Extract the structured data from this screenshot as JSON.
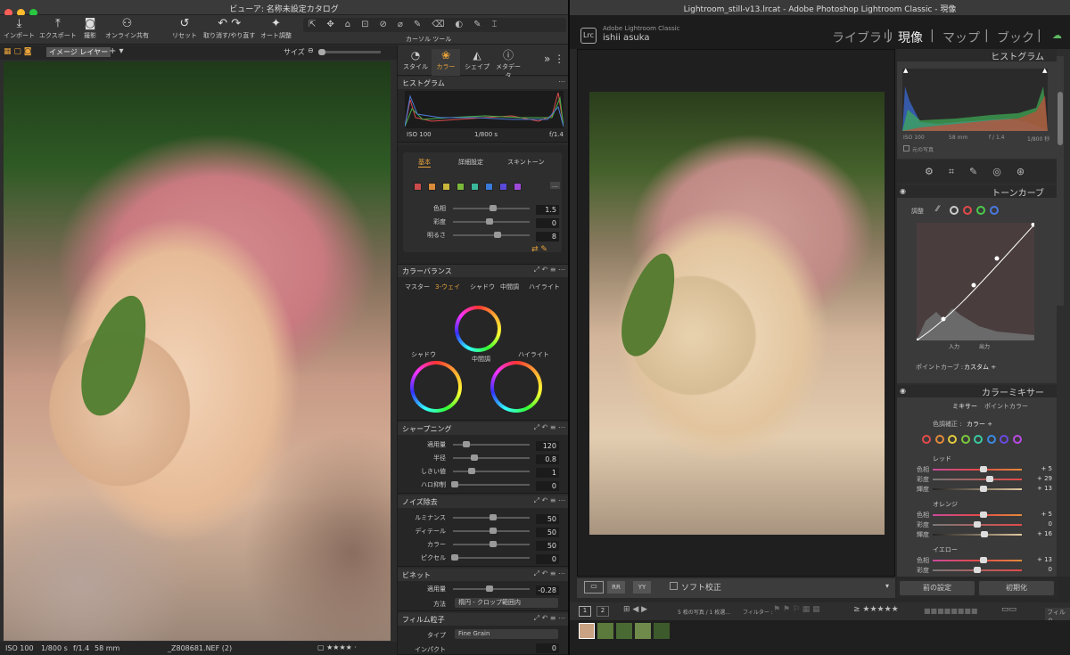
{
  "c1": {
    "window_title": "ビューア: 名称未設定カタログ",
    "tools": [
      {
        "label": "インポート",
        "icon": "import-icon",
        "glyph": "⤓"
      },
      {
        "label": "エクスポート",
        "icon": "export-icon",
        "glyph": "⤒"
      },
      {
        "label": "撮影",
        "icon": "camera-icon",
        "glyph": "◙"
      },
      {
        "label": "オンライン共有",
        "icon": "share-icon",
        "glyph": "⚇"
      },
      {
        "label": "リセット",
        "icon": "reset-icon",
        "glyph": "↺"
      },
      {
        "label": "取り消す/やり直す",
        "icon": "undo-icon",
        "glyph": "↶ ↷"
      },
      {
        "label": "オート調整",
        "icon": "auto-adjust-icon",
        "glyph": "✦"
      }
    ],
    "cursor_tools_label": "カーソル ツール",
    "view_mode": "イメージ レイヤー",
    "size_label": "サイズ",
    "sidebar_tabs": [
      "スタイル",
      "カラー",
      "シェイプ",
      "メタデータ"
    ],
    "histogram": {
      "title": "ヒストグラム",
      "iso": "ISO 100",
      "shutter": "1/800 s",
      "aperture": "f/1.4"
    },
    "color_editor": {
      "tabs": [
        "基本",
        "詳細設定",
        "スキントーン"
      ],
      "rows": [
        {
          "label": "色相",
          "value": "1.5"
        },
        {
          "label": "彩度",
          "value": "0"
        },
        {
          "label": "明るさ",
          "value": "8"
        }
      ],
      "swatches": [
        "#c94b4b",
        "#d98a3a",
        "#c9b63a",
        "#7ab83a",
        "#3ab89a",
        "#3a7ad9",
        "#5a4ad9",
        "#a04ad9"
      ],
      "swatch_more": "..."
    },
    "color_balance": {
      "title": "カラーバランス",
      "tabs": [
        "マスター",
        "3-ウェイ",
        "シャドウ",
        "中間調",
        "ハイライト"
      ],
      "wheels": [
        "シャドウ",
        "中間調",
        "ハイライト"
      ]
    },
    "sharpening": {
      "title": "シャープニング",
      "rows": [
        {
          "label": "適用量",
          "value": "120",
          "pos": 0.15
        },
        {
          "label": "半径",
          "value": "0.8",
          "pos": 0.25
        },
        {
          "label": "しきい値",
          "value": "1",
          "pos": 0.22
        },
        {
          "label": "ハロ抑制",
          "value": "0",
          "pos": 0.0
        }
      ]
    },
    "noise": {
      "title": "ノイズ除去",
      "rows": [
        {
          "label": "ルミナンス",
          "value": "50",
          "pos": 0.5
        },
        {
          "label": "ディテール",
          "value": "50",
          "pos": 0.5
        },
        {
          "label": "カラー",
          "value": "50",
          "pos": 0.5
        },
        {
          "label": "ピクセル",
          "value": "0",
          "pos": 0.0
        }
      ]
    },
    "vignette": {
      "title": "ビネット",
      "rows": [
        {
          "label": "適用量",
          "value": "-0.28",
          "pos": 0.45
        }
      ],
      "method_label": "方法",
      "method_value": "楕円 - クロップ範囲内"
    },
    "grain": {
      "title": "フィルム粒子",
      "type_label": "タイプ",
      "type_value": "Fine Grain",
      "impact_label": "インパクト",
      "impact_value": "0"
    },
    "status": {
      "iso": "ISO 100",
      "shutter": "1/800 s",
      "aperture": "f/1.4",
      "focal": "58 mm",
      "filename": "_Z808681.NEF (2)"
    }
  },
  "lr": {
    "window_title": "Lightroom_still-v13.lrcat - Adobe Photoshop Lightroom Classic - 現像",
    "brand": "Adobe Lightroom Classic",
    "user": "ishii asuka",
    "modules": [
      "ライブラリ",
      "現像",
      "マップ",
      "ブック"
    ],
    "histogram": {
      "title": "ヒストグラム",
      "iso": "ISO 100",
      "focal": "58 mm",
      "aperture": "f / 1.4",
      "shutter": "1/800 秒",
      "original": "元の写真"
    },
    "tone_curve": {
      "title": "トーンカーブ",
      "adjust": "調整",
      "input": "入力",
      "output": "出力",
      "point_curve_label": "ポイントカーブ :",
      "point_curve_value": "カスタム ÷"
    },
    "mixer": {
      "title": "カラーミキサー",
      "tabs": [
        "ミキサー",
        "ポイントカラー"
      ],
      "adjust_label": "色調補正 :",
      "adjust_value": "カラー ÷",
      "colors": [
        "#e34a4a",
        "#e38a3a",
        "#e3c93a",
        "#7ac93a",
        "#3ac9a0",
        "#3a8ae3",
        "#6a4ae3",
        "#b94ae3"
      ],
      "groups": [
        {
          "name": "レッド",
          "rows": [
            {
              "label": "色相",
              "value": "+ 5",
              "pos": 0.57
            },
            {
              "label": "彩度",
              "value": "+ 29",
              "pos": 0.64
            },
            {
              "label": "輝度",
              "value": "+ 13",
              "pos": 0.57
            }
          ]
        },
        {
          "name": "オレンジ",
          "rows": [
            {
              "label": "色相",
              "value": "+ 5",
              "pos": 0.57
            },
            {
              "label": "彩度",
              "value": "0",
              "pos": 0.5
            },
            {
              "label": "輝度",
              "value": "+ 16",
              "pos": 0.58
            }
          ]
        },
        {
          "name": "イエロー",
          "rows": [
            {
              "label": "色相",
              "value": "+ 13",
              "pos": 0.57
            },
            {
              "label": "彩度",
              "value": "0",
              "pos": 0.5
            }
          ]
        }
      ]
    },
    "soft_proof": "ソフト校正",
    "prev_btn": "前の設定",
    "reset_btn": "初期化",
    "filmstrip": {
      "info": "5 枚の写真 / 1 枚選...",
      "filter_label": "フィルター :",
      "filter_right": "フィルタ",
      "page_nums": [
        "1",
        "2"
      ]
    }
  }
}
